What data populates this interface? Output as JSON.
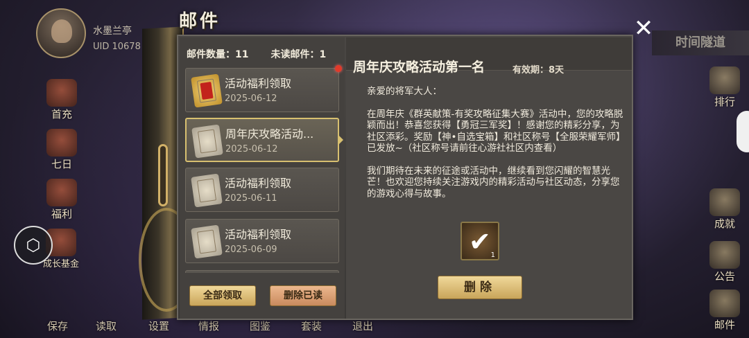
{
  "player": {
    "name": "水墨兰亭",
    "uid": "UID  10678"
  },
  "left_menu": [
    "首充",
    "七日",
    "福利",
    "成长基金"
  ],
  "right_menu": [
    "排行",
    "成就",
    "公告",
    "邮件"
  ],
  "bottom_menu": [
    "保存",
    "读取",
    "设置",
    "情报",
    "图鉴",
    "套装",
    "退出"
  ],
  "top_right_label": "时间隧道",
  "close_glyph": "✕",
  "mail": {
    "title": "邮件",
    "count_label": "邮件数量：11",
    "unread_label": "未读邮件：1",
    "items": [
      {
        "title": "活动福利领取",
        "date": "2025-06-12",
        "unread": true,
        "selected": false
      },
      {
        "title": "周年庆攻略活动...",
        "date": "2025-06-12",
        "unread": false,
        "selected": true
      },
      {
        "title": "活动福利领取",
        "date": "2025-06-11",
        "unread": false,
        "selected": false
      },
      {
        "title": "活动福利领取",
        "date": "2025-06-09",
        "unread": false,
        "selected": false
      }
    ],
    "collect_all_label": "全部领取",
    "delete_read_label": "删除已读",
    "detail": {
      "title": "周年庆攻略活动第一名",
      "expire": "有效期：8天",
      "greeting": "亲爱的将军大人：",
      "para1": "在周年庆《群英献策-有奖攻略征集大赛》活动中，您的攻略脱颖而出！恭喜您获得【勇冠三军奖】！感谢您的精彩分享，为社区添彩。奖励【神•自选宝箱】和社区称号【全服荣耀军师】已发放~（社区称号请前往心游社社区内查看）",
      "para2": "我们期待在未来的征途或活动中，继续看到您闪耀的智慧光芒！也欢迎您持续关注游戏内的精彩活动与社区动态，分享您的游戏心得与故事。",
      "attachment_qty": "1",
      "attachment_mark": "✔",
      "delete_label": "删除"
    }
  }
}
